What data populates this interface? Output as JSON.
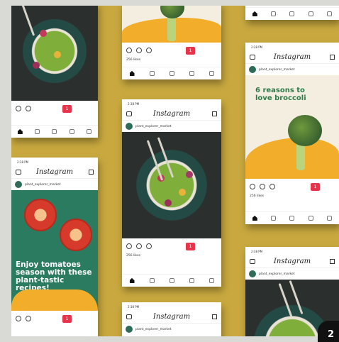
{
  "app_name": "Instagram",
  "accounts": {
    "main": "plant_explorer_market",
    "left": "plant_explorer_market",
    "right": "plant_explorer_market"
  },
  "likes_label": "256 likes",
  "notif_count": "1",
  "posts": {
    "broccoli_headline": "6 reasons to love broccoli",
    "tomato_text": "Enjoy tomatoes season with these plant-tastic recipes!"
  },
  "status_time": "2:38 PM",
  "corner_badge": "2",
  "colors": {
    "background": "#c9a93f",
    "accent_orange": "#f2ad2a",
    "accent_green": "#2b7b60",
    "notif_red": "#e8344a"
  }
}
